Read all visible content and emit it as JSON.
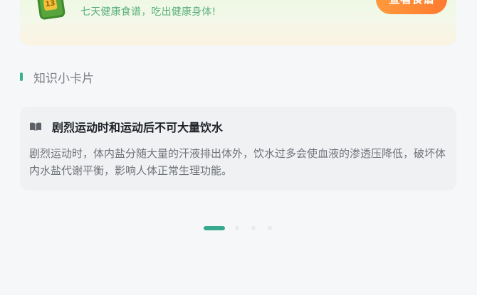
{
  "banner": {
    "icon_name": "recipe-book-icon",
    "icon_text": "13",
    "subtitle": "七天健康食谱，吃出健康身体!",
    "button_label": "查看食谱"
  },
  "section": {
    "title": "知识小卡片"
  },
  "card": {
    "icon_name": "book-icon",
    "title": "剧烈运动时和运动后不可大量饮水",
    "body": "剧烈运动时，体内盐分随大量的汗液排出体外，饮水过多会使血液的渗透压降低，破坏体内水盐代谢平衡，影响人体正常生理功能。"
  },
  "pager": {
    "count": 4,
    "active_index": 0
  },
  "colors": {
    "accent_green": "#36a98f",
    "button_orange": "#ff8a33",
    "subtitle_green": "#58b07c"
  }
}
